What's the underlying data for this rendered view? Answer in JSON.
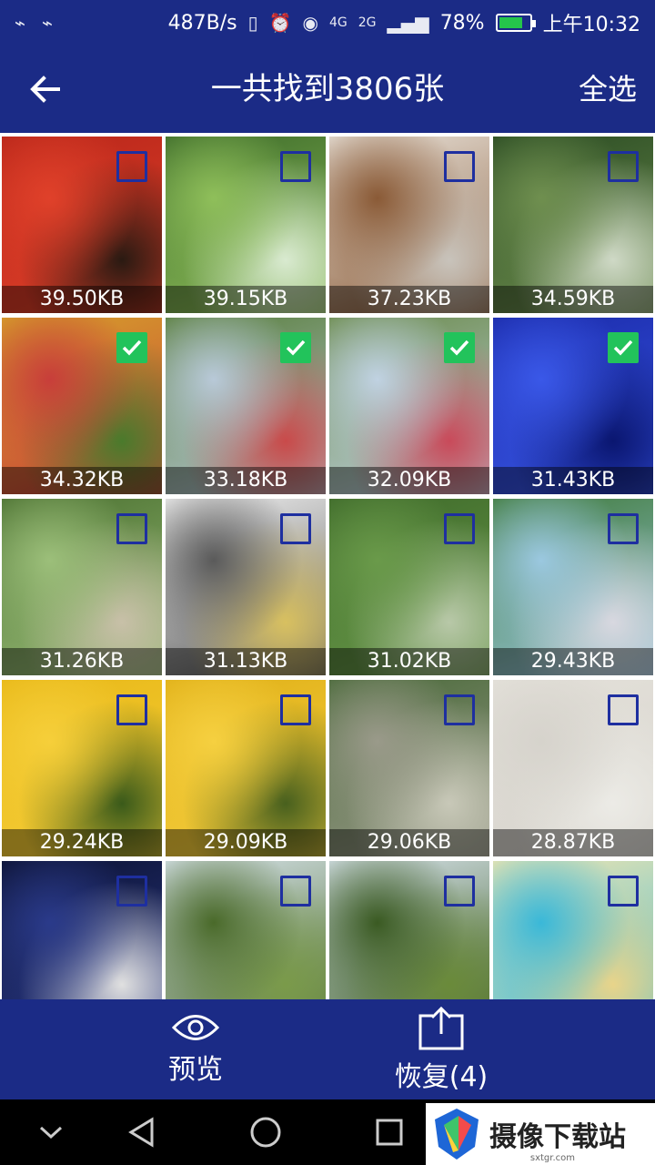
{
  "status_bar": {
    "speed": "487B/s",
    "network": "4G",
    "signal_label": "2G",
    "battery_percent": "78%",
    "battery_level": 0.78,
    "time": "上午10:32"
  },
  "app_bar": {
    "title": "一共找到3806张",
    "select_all": "全选"
  },
  "colors": {
    "primary": "#1b2b86",
    "checkbox_border": "#1e2fa0",
    "checked": "#22c35b"
  },
  "photos": [
    {
      "size": "39.50KB",
      "checked": false
    },
    {
      "size": "39.15KB",
      "checked": false
    },
    {
      "size": "37.23KB",
      "checked": false
    },
    {
      "size": "34.59KB",
      "checked": false
    },
    {
      "size": "34.32KB",
      "checked": true
    },
    {
      "size": "33.18KB",
      "checked": true
    },
    {
      "size": "32.09KB",
      "checked": true
    },
    {
      "size": "31.43KB",
      "checked": true
    },
    {
      "size": "31.26KB",
      "checked": false
    },
    {
      "size": "31.13KB",
      "checked": false
    },
    {
      "size": "31.02KB",
      "checked": false
    },
    {
      "size": "29.43KB",
      "checked": false
    },
    {
      "size": "29.24KB",
      "checked": false
    },
    {
      "size": "29.09KB",
      "checked": false
    },
    {
      "size": "29.06KB",
      "checked": false
    },
    {
      "size": "28.87KB",
      "checked": false
    },
    {
      "size": "",
      "checked": false
    },
    {
      "size": "",
      "checked": false
    },
    {
      "size": "",
      "checked": false
    },
    {
      "size": "",
      "checked": false
    }
  ],
  "bottom_bar": {
    "preview_label": "预览",
    "recover_label": "恢复(4)"
  },
  "watermark": {
    "text": "摄像下载站",
    "sub": "sxtgr.com"
  }
}
